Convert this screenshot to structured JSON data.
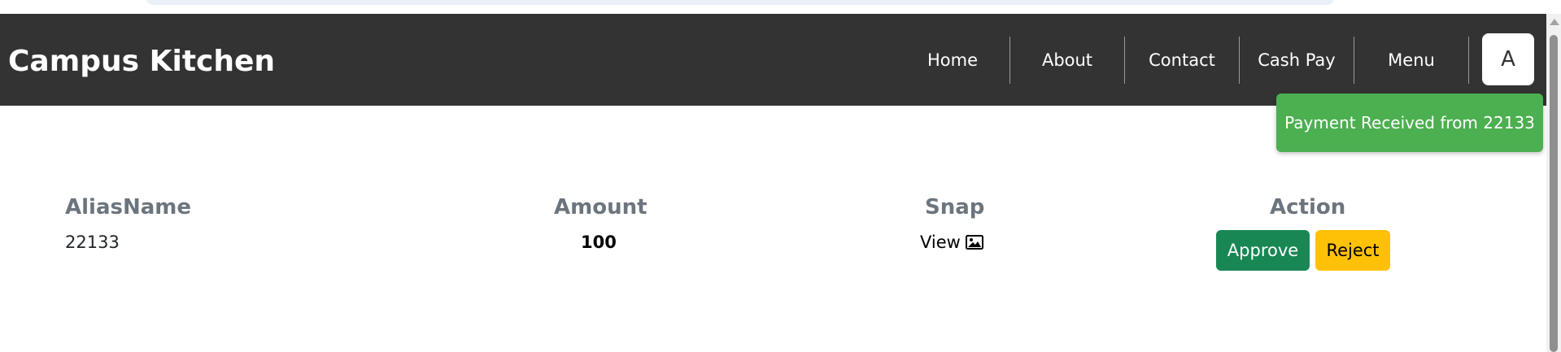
{
  "navbar": {
    "brand": "Campus Kitchen",
    "links": [
      {
        "label": "Home"
      },
      {
        "label": "About"
      },
      {
        "label": "Contact"
      },
      {
        "label": "Cash Pay"
      },
      {
        "label": "Menu"
      }
    ],
    "avatar_letter": "A"
  },
  "toast": {
    "message": "Payment Received from 22133",
    "color": "#4caf50"
  },
  "table": {
    "headers": {
      "alias": "AliasName",
      "amount": "Amount",
      "snap": "Snap",
      "action": "Action"
    },
    "rows": [
      {
        "alias": "22133",
        "amount": "100",
        "snap_label": "View",
        "snap_icon": "image-icon",
        "approve_label": "Approve",
        "reject_label": "Reject"
      }
    ]
  },
  "colors": {
    "navbar_bg": "#333333",
    "approve": "#198754",
    "reject": "#ffc107",
    "header_text": "#6c757d"
  }
}
